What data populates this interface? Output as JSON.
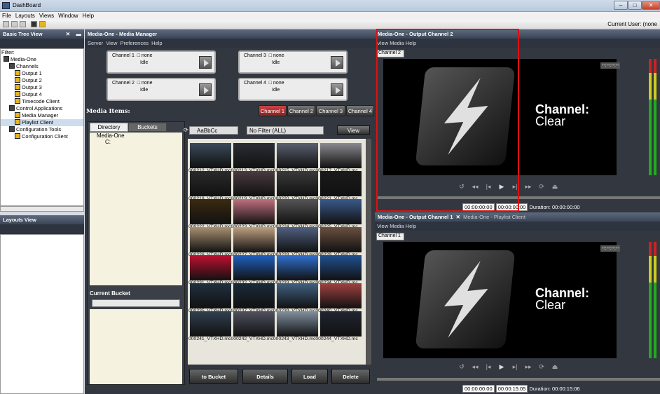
{
  "app": {
    "title": "DashBoard",
    "current_user": "Current User: (none"
  },
  "menu": [
    "File",
    "Layouts",
    "Views",
    "Window",
    "Help"
  ],
  "tree_panel": {
    "title": "Basic Tree View",
    "filter_label": "Filter:",
    "items": [
      {
        "label": "Media-One",
        "indent": 0
      },
      {
        "label": "Channels",
        "indent": 1
      },
      {
        "label": "Output 1",
        "indent": 2
      },
      {
        "label": "Output 2",
        "indent": 2
      },
      {
        "label": "Output 3",
        "indent": 2
      },
      {
        "label": "Output 4",
        "indent": 2
      },
      {
        "label": "Timecode Client",
        "indent": 2
      },
      {
        "label": "Control Applications",
        "indent": 1
      },
      {
        "label": "Media Manager",
        "indent": 2
      },
      {
        "label": "Playlist Client",
        "indent": 2,
        "selected": true
      },
      {
        "label": "Configuration Tools",
        "indent": 1
      },
      {
        "label": "Configuration Client",
        "indent": 2
      }
    ]
  },
  "layouts_panel": {
    "title": "Layouts View"
  },
  "media_manager": {
    "title": "Media-One - Media Manager",
    "menu": [
      "Server",
      "View",
      "Preferences",
      "Help"
    ],
    "channels": [
      {
        "name": "Channel 1",
        "media": "none",
        "status": "Idle"
      },
      {
        "name": "Channel 3",
        "media": "none",
        "status": "Idle"
      },
      {
        "name": "Channel 2",
        "media": "none",
        "status": "Idle"
      },
      {
        "name": "Channel 4",
        "media": "none",
        "status": "Idle"
      }
    ],
    "media_items_label": "Media Items:",
    "channel_tabs": [
      "Channel 1",
      "Channel 2",
      "Channel 3",
      "Channel 4"
    ],
    "left_tabs": [
      "Directory",
      "Buckets"
    ],
    "dir_tree": [
      "Media-One",
      "C:"
    ],
    "current_bucket_label": "Current Bucket",
    "search_value": "AaBbCc",
    "filter_value": "No Filter (ALL)",
    "view_label": "View",
    "thumb_rows": [
      [
        "000212_VTXHD.mc",
        "000213_VTXHD.mc",
        "000215_VTXHD.mc",
        "000217_VTXHD.mc"
      ],
      [
        "000218_VTXHD.mc",
        "000219_VTXHD.mc",
        "000220_VTXHD.mc",
        "000221_VTXHD.mc"
      ],
      [
        "000222_VTXHD.mc",
        "000223_VTXHD.mc",
        "000224_VTXHD.mc",
        "000225_VTXHD.mc"
      ],
      [
        "000226_VTXHD.mc",
        "000227_VTXHD.mc",
        "000228_VTXHD.mc",
        "000229_VTXHD.mc"
      ],
      [
        "000231_VTXHD.mc",
        "000232_VTXHD.mc",
        "000233_VTXHD.mc",
        "000234_VTXHD.mc"
      ],
      [
        "000235_VTXHD.mc",
        "000237_VTXHD.mc",
        "000239_VTXHD.mc",
        "000240_VTXHD.mc"
      ],
      [
        "000241_VTXHD.mc",
        "000242_VTXHD.mc",
        "000243_VTXHD.mc",
        "000244_VTXHD.mc"
      ]
    ],
    "thumb_colors": [
      [
        "#3a4a5a",
        "#2a2e35",
        "#5a6070",
        "#8a8a90"
      ],
      [
        "#2a2a2a",
        "#4a3a40",
        "#3a3a3a",
        "#1a1a1a"
      ],
      [
        "#3a2a10",
        "#c07080",
        "#555",
        "#3a5a8a"
      ],
      [
        "#a89070",
        "#c0a080",
        "#506080",
        "#6a5040"
      ],
      [
        "#c01030",
        "#2060c0",
        "#3070d0",
        "#205090"
      ],
      [
        "#203040",
        "#1a2a3a",
        "#406080",
        "#a04040"
      ],
      [
        "#304050",
        "#505060",
        "#8090a0",
        "#202530"
      ]
    ],
    "buttons": [
      "to Bucket",
      "Details",
      "Load",
      "Delete"
    ]
  },
  "output2": {
    "title": "Media-One - Output Channel 2",
    "menu": [
      "View",
      "Media",
      "Help"
    ],
    "channel": "Channel 2",
    "overlay_line1": "Channel:",
    "overlay_line2": "Clear",
    "tc_in": "00:00:00:00",
    "tc_out": "00:00:00:00",
    "duration": "Duration: 00:00:00:00",
    "tc_display": "--:--:--:--"
  },
  "output1": {
    "tabs": [
      "Media-One - Output Channel 1",
      "Media-One - Playlist Client"
    ],
    "menu": [
      "View",
      "Media",
      "Help"
    ],
    "channel": "Channel 1",
    "overlay_line1": "Channel:",
    "overlay_line2": "Clear",
    "tc_in": "00:00:00:00",
    "tc_out": "00:00:15:05",
    "duration": "Duration: 00:00:15:06",
    "tc_display": "--:--:--:--"
  },
  "highlight_color": "#e01010"
}
